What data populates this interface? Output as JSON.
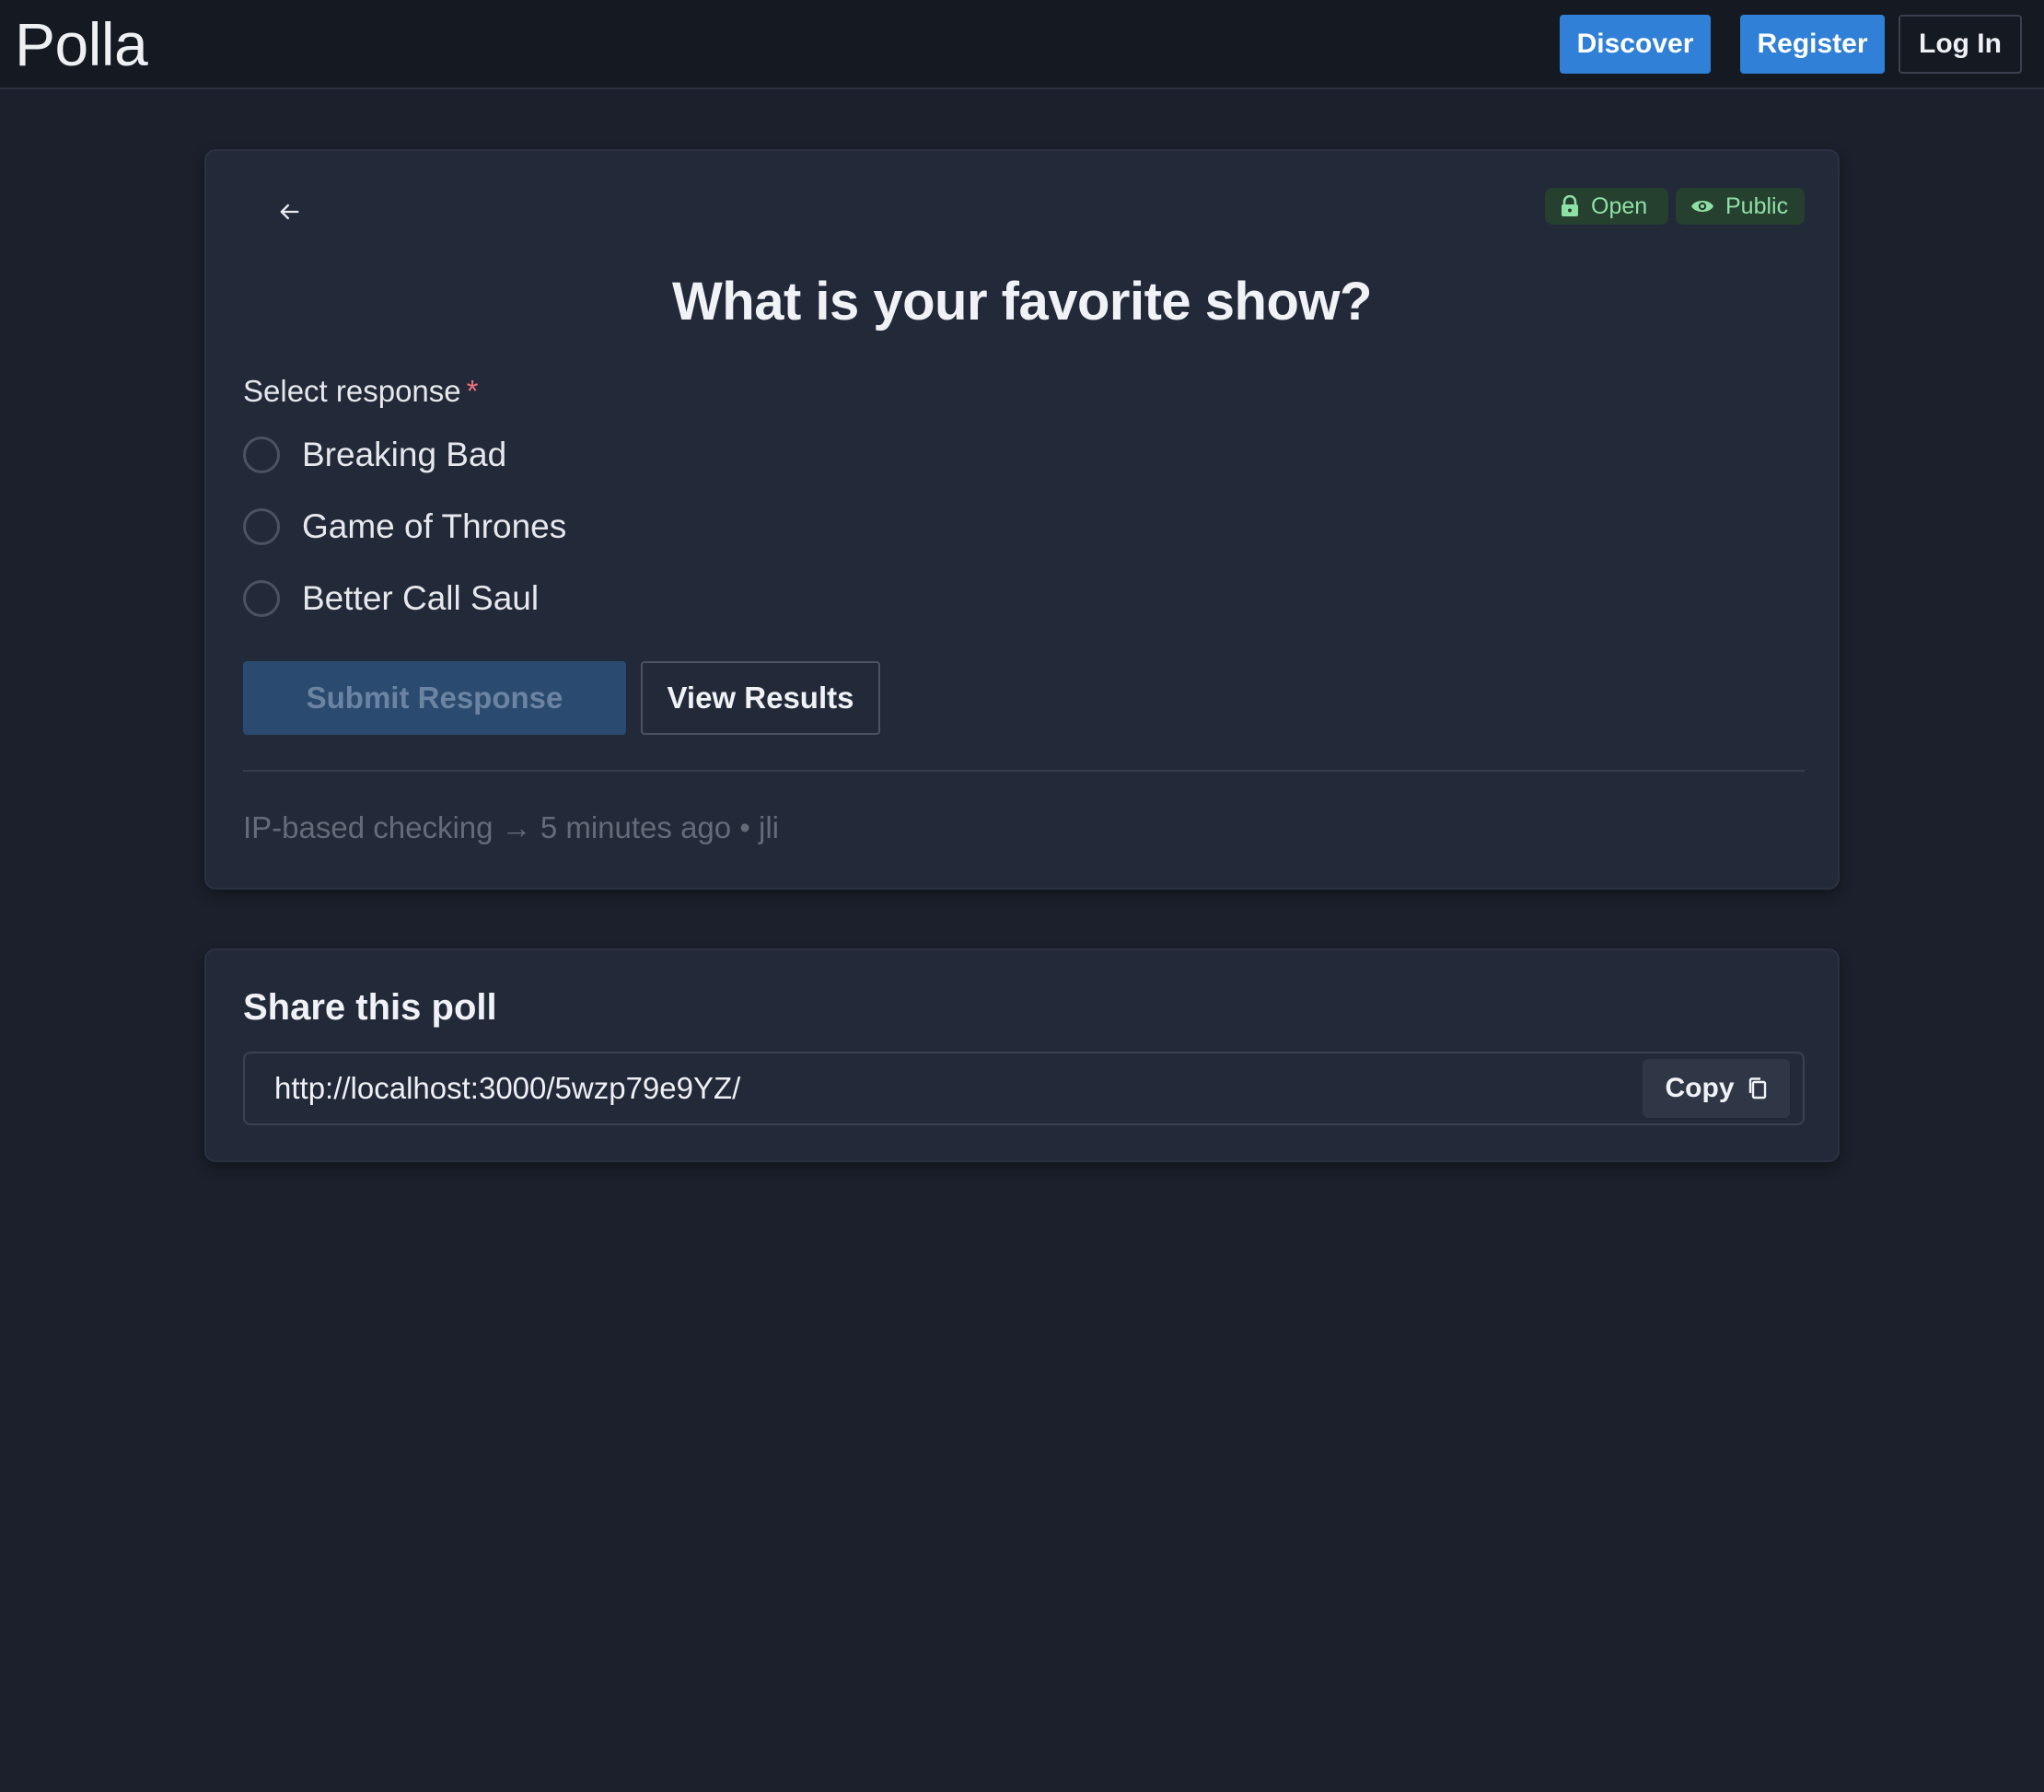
{
  "app": {
    "name": "Polla"
  },
  "nav": {
    "discover": "Discover",
    "register": "Register",
    "login": "Log In"
  },
  "poll": {
    "badges": {
      "status": "Open",
      "visibility": "Public"
    },
    "question": "What is your favorite show?",
    "select_label": "Select response",
    "required_marker": "*",
    "options": [
      {
        "label": "Breaking Bad"
      },
      {
        "label": "Game of Thrones"
      },
      {
        "label": "Better Call Saul"
      }
    ],
    "submit_label": "Submit Response",
    "results_label": "View Results",
    "meta": "IP-based checking → 5 minutes ago • jli"
  },
  "share": {
    "title": "Share this poll",
    "url": "http://localhost:3000/5wzp79e9YZ/",
    "copy_label": "Copy"
  },
  "colors": {
    "accent": "#2f80d6",
    "badge_text": "#8fe0a5",
    "badge_bg": "#25402f",
    "background": "#1b202c",
    "card": "#222938"
  }
}
